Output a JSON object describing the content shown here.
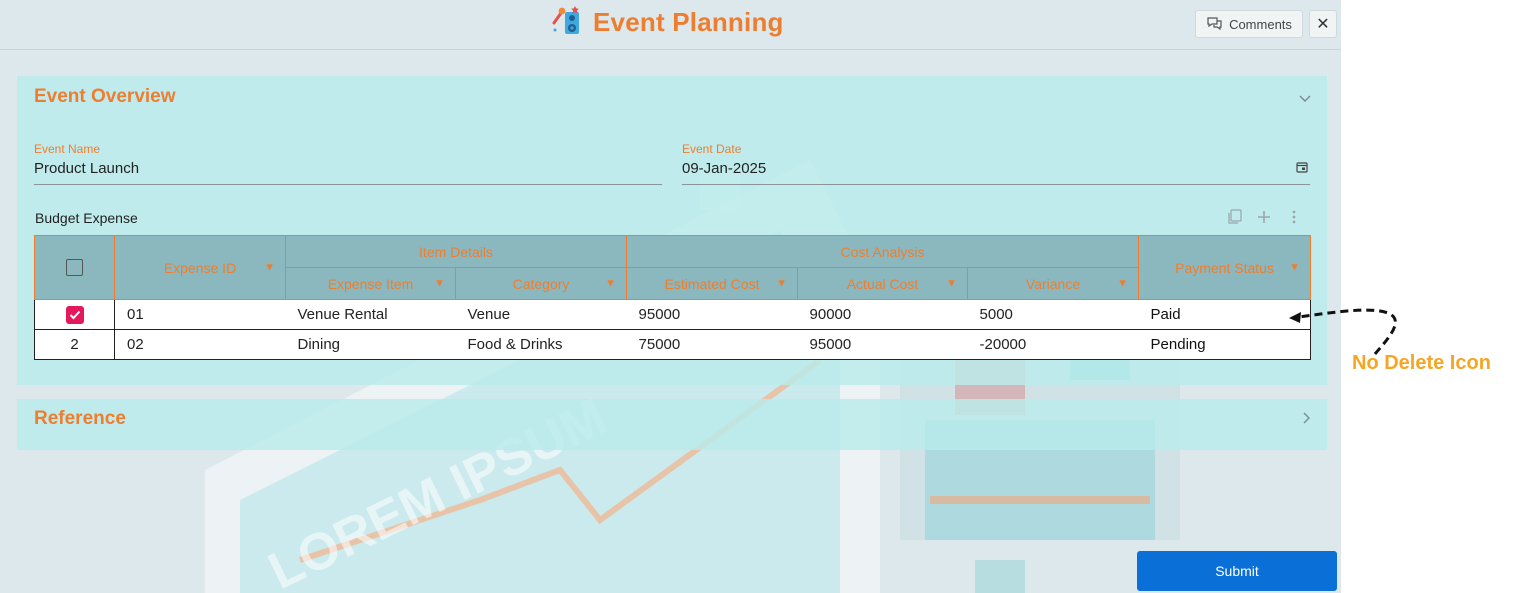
{
  "app": {
    "title": "Event Planning",
    "comments_label": "Comments",
    "close_label": "✕",
    "logo_icon": "event-speaker-icon"
  },
  "background": {
    "watermark_text": "LOREM IPSUM"
  },
  "overview": {
    "title": "Event Overview",
    "event_name": {
      "label": "Event Name",
      "value": "Product Launch"
    },
    "event_date": {
      "label": "Event Date",
      "value": "09-Jan-2025"
    },
    "grid": {
      "label": "Budget Expense",
      "group_headers": {
        "item_details": "Item Details",
        "cost_analysis": "Cost Analysis"
      },
      "columns": {
        "expense_id": "Expense ID",
        "expense_item": "Expense Item",
        "category": "Category",
        "estimated_cost": "Estimated Cost",
        "actual_cost": "Actual Cost",
        "variance": "Variance",
        "payment_status": "Payment Status"
      },
      "rows": [
        {
          "selected": true,
          "index": "",
          "expense_id": "01",
          "expense_item": "Venue Rental",
          "category": "Venue",
          "estimated_cost": "95000",
          "actual_cost": "90000",
          "variance": "5000",
          "payment_status": "Paid"
        },
        {
          "selected": false,
          "index": "2",
          "expense_id": "02",
          "expense_item": "Dining",
          "category": "Food & Drinks",
          "estimated_cost": "75000",
          "actual_cost": "95000",
          "variance": "-20000",
          "payment_status": "Pending"
        }
      ]
    }
  },
  "reference": {
    "title": "Reference"
  },
  "footer": {
    "submit_label": "Submit"
  },
  "annotation": {
    "text": "No Delete Icon"
  },
  "colors": {
    "accent": "#ee7e2f",
    "primary_button": "#0a6fd6",
    "checkbox_checked": "#e3195a",
    "annotation": "#f5a623"
  }
}
